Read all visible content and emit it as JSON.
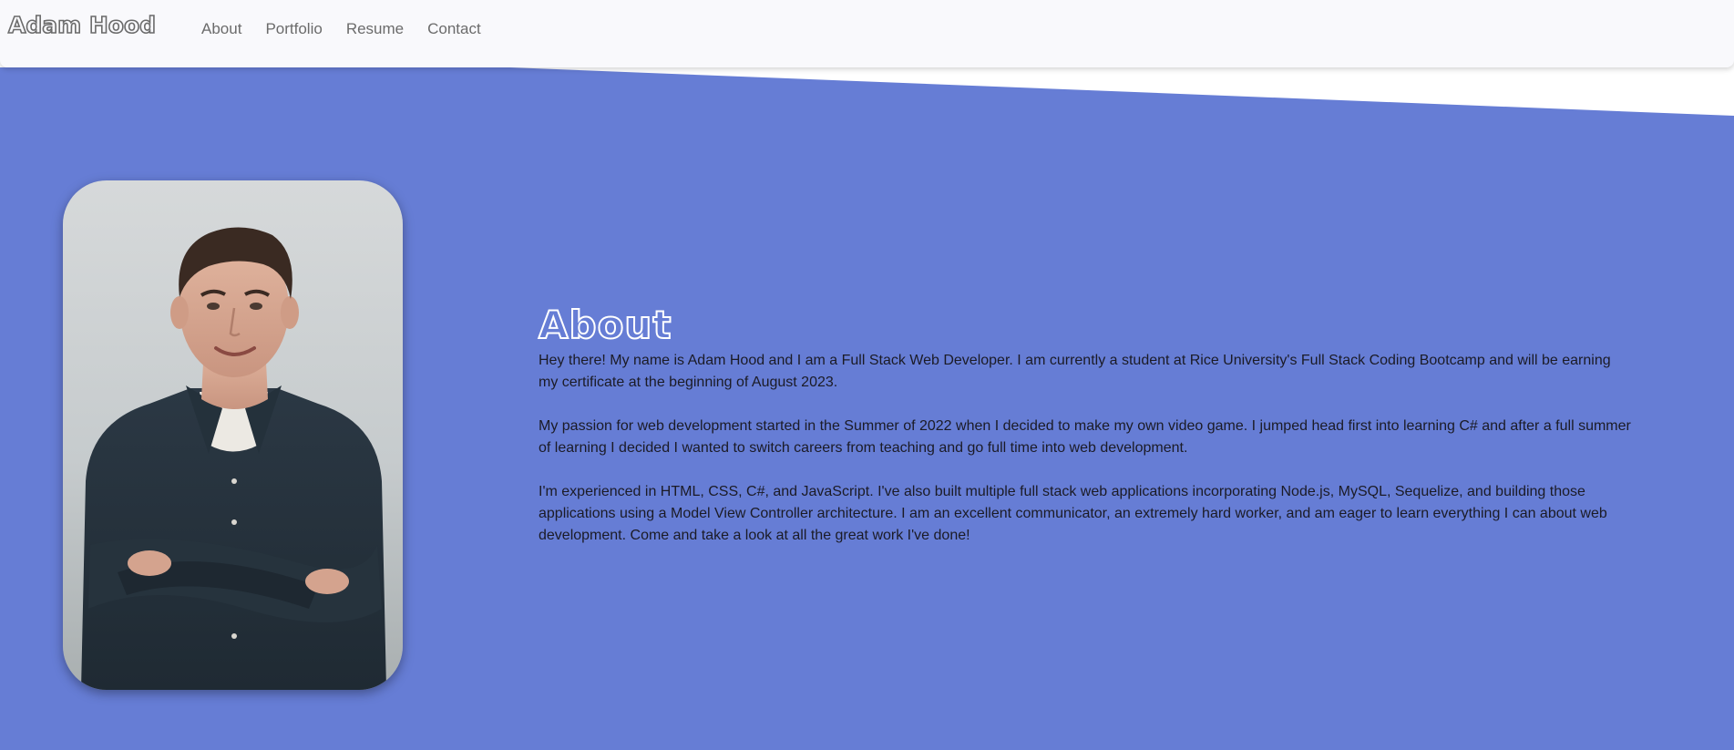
{
  "brand": {
    "name": "Adam Hood"
  },
  "nav": {
    "items": [
      {
        "label": "About"
      },
      {
        "label": "Portfolio"
      },
      {
        "label": "Resume"
      },
      {
        "label": "Contact"
      }
    ]
  },
  "about": {
    "title": "About",
    "paragraphs": [
      "Hey there! My name is Adam Hood and I am a Full Stack Web Developer. I am currently a student at Rice University's Full Stack Coding Bootcamp and will be earning my certificate at the beginning of August 2023.",
      "My passion for web development started in the Summer of 2022 when I decided to make my own video game. I jumped head first into learning C# and after a full summer of learning I decided I wanted to switch careers from teaching and go full time into web development.",
      "I'm experienced in HTML, CSS, C#, and JavaScript. I've also built multiple full stack web applications incorporating Node.js, MySQL, Sequelize, and building those applications using a Model View Controller architecture. I am an excellent communicator, an extremely hard worker, and am eager to learn everything I can about web development. Come and take a look at all the great work I've done!"
    ]
  },
  "colors": {
    "background": "#667dd5",
    "navbar": "#f9f9fc",
    "nav_text": "#6b6b6b",
    "body_text": "#1b1b26",
    "title_outline": "#ffffff"
  }
}
